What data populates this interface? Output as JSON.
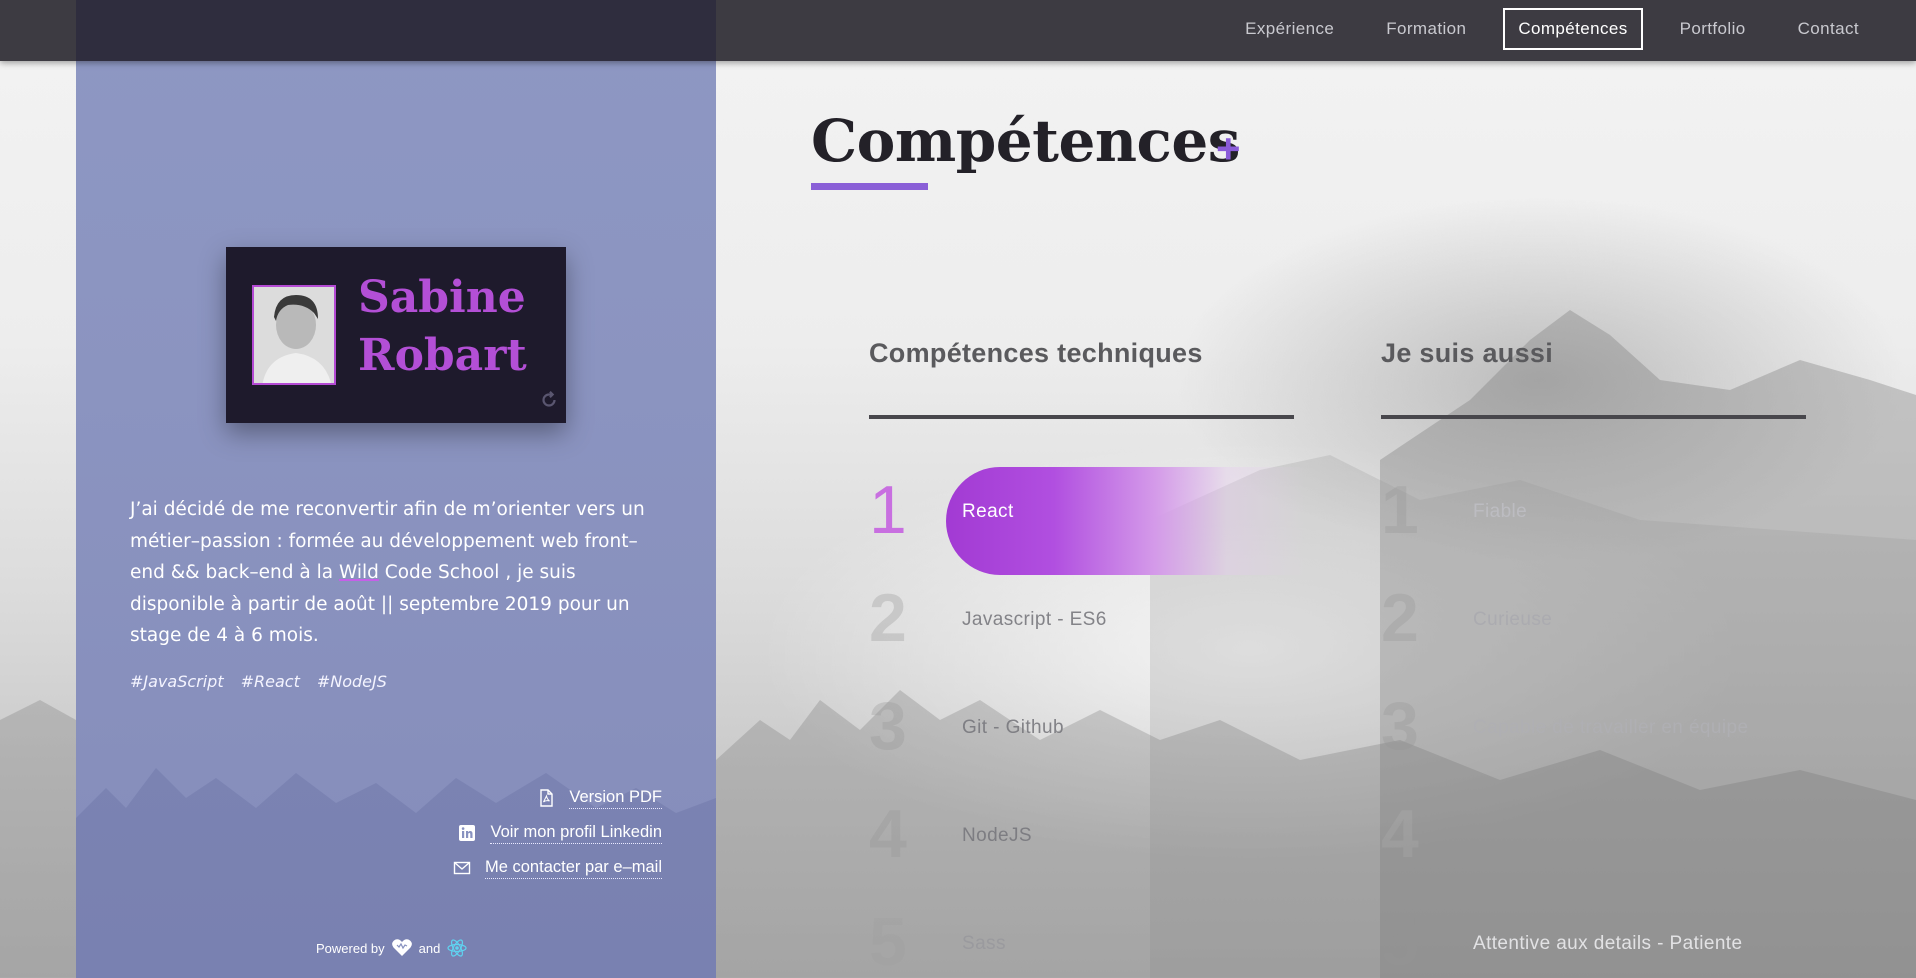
{
  "nav": {
    "items": [
      {
        "label": "Expérience",
        "active": false
      },
      {
        "label": "Formation",
        "active": false
      },
      {
        "label": "Compétences",
        "active": true
      },
      {
        "label": "Portfolio",
        "active": false
      },
      {
        "label": "Contact",
        "active": false
      }
    ]
  },
  "profile": {
    "first_name": "Sabine",
    "last_name": "Robart",
    "bio_part1": "J’ai décidé de me reconvertir afin de m’orienter vers un métier–passion : formée au développement web front–end && back–end à la ",
    "bio_highlight": "Wild",
    "bio_part2": " Code School , je suis disponible à partir de août || septembre 2019 pour un stage de 4 à 6 mois.",
    "tags": [
      "#JavaScript",
      "#React",
      "#NodeJS"
    ]
  },
  "links": {
    "pdf": "Version PDF",
    "linkedin": "Voir mon profil Linkedin",
    "email": "Me contacter par e–mail"
  },
  "footer": {
    "powered_by": "Powered by",
    "and": "and"
  },
  "main": {
    "title": "Compétences",
    "plus": "+",
    "tech_column": {
      "title": "Compétences techniques",
      "skills": [
        {
          "num": "1",
          "label": "React"
        },
        {
          "num": "2",
          "label": "Javascript - ES6"
        },
        {
          "num": "3",
          "label": "Git - Github"
        },
        {
          "num": "4",
          "label": "NodeJS"
        },
        {
          "num": "5",
          "label": "Sass"
        }
      ]
    },
    "soft_column": {
      "title": "Je suis aussi",
      "skills": [
        {
          "num": "1",
          "label": "Fiable"
        },
        {
          "num": "2",
          "label": "Curieuse"
        },
        {
          "num": "3",
          "label": "Capable de travailler en équipe"
        },
        {
          "num": "4",
          "label": ""
        },
        {
          "num": "5",
          "label": "Attentive aux details - Patiente"
        }
      ]
    }
  },
  "colors": {
    "accent": "#b34fd6",
    "underline": "#8a5fd7",
    "sidebar": "#8892c0",
    "topbar": "#3d3b42"
  }
}
